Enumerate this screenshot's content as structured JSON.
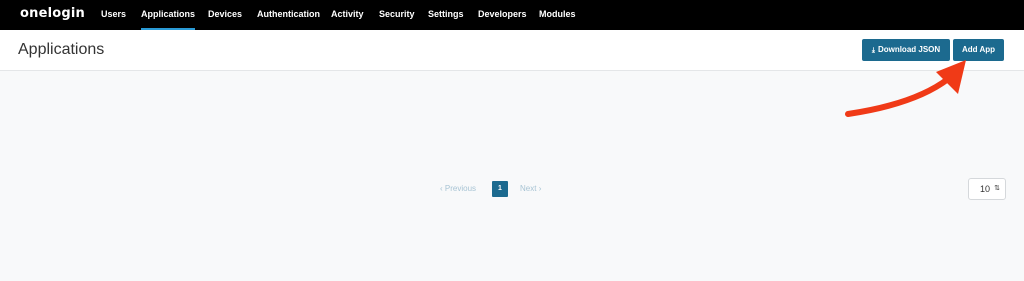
{
  "brand": {
    "logo": "onelogin"
  },
  "nav": {
    "items": [
      {
        "label": "Users",
        "active": false
      },
      {
        "label": "Applications",
        "active": true
      },
      {
        "label": "Devices",
        "active": false
      },
      {
        "label": "Authentication",
        "active": false
      },
      {
        "label": "Activity",
        "active": false
      },
      {
        "label": "Security",
        "active": false
      },
      {
        "label": "Settings",
        "active": false
      },
      {
        "label": "Developers",
        "active": false
      },
      {
        "label": "Modules",
        "active": false
      }
    ]
  },
  "header": {
    "title": "Applications",
    "download_label": "Download JSON",
    "add_label": "Add App"
  },
  "pagination": {
    "prev_label": "Previous",
    "next_label": "Next",
    "current_page": "1"
  },
  "per_page": {
    "value": "10"
  },
  "colors": {
    "accent": "#1c6a8f",
    "nav_bg": "#000000",
    "active_underline": "#2a9bd6",
    "annotation_arrow": "#f03a17"
  },
  "icons": {
    "download": "download-icon",
    "prev": "chevron-left-icon",
    "next": "chevron-right-icon",
    "select": "sort-arrows-icon"
  }
}
